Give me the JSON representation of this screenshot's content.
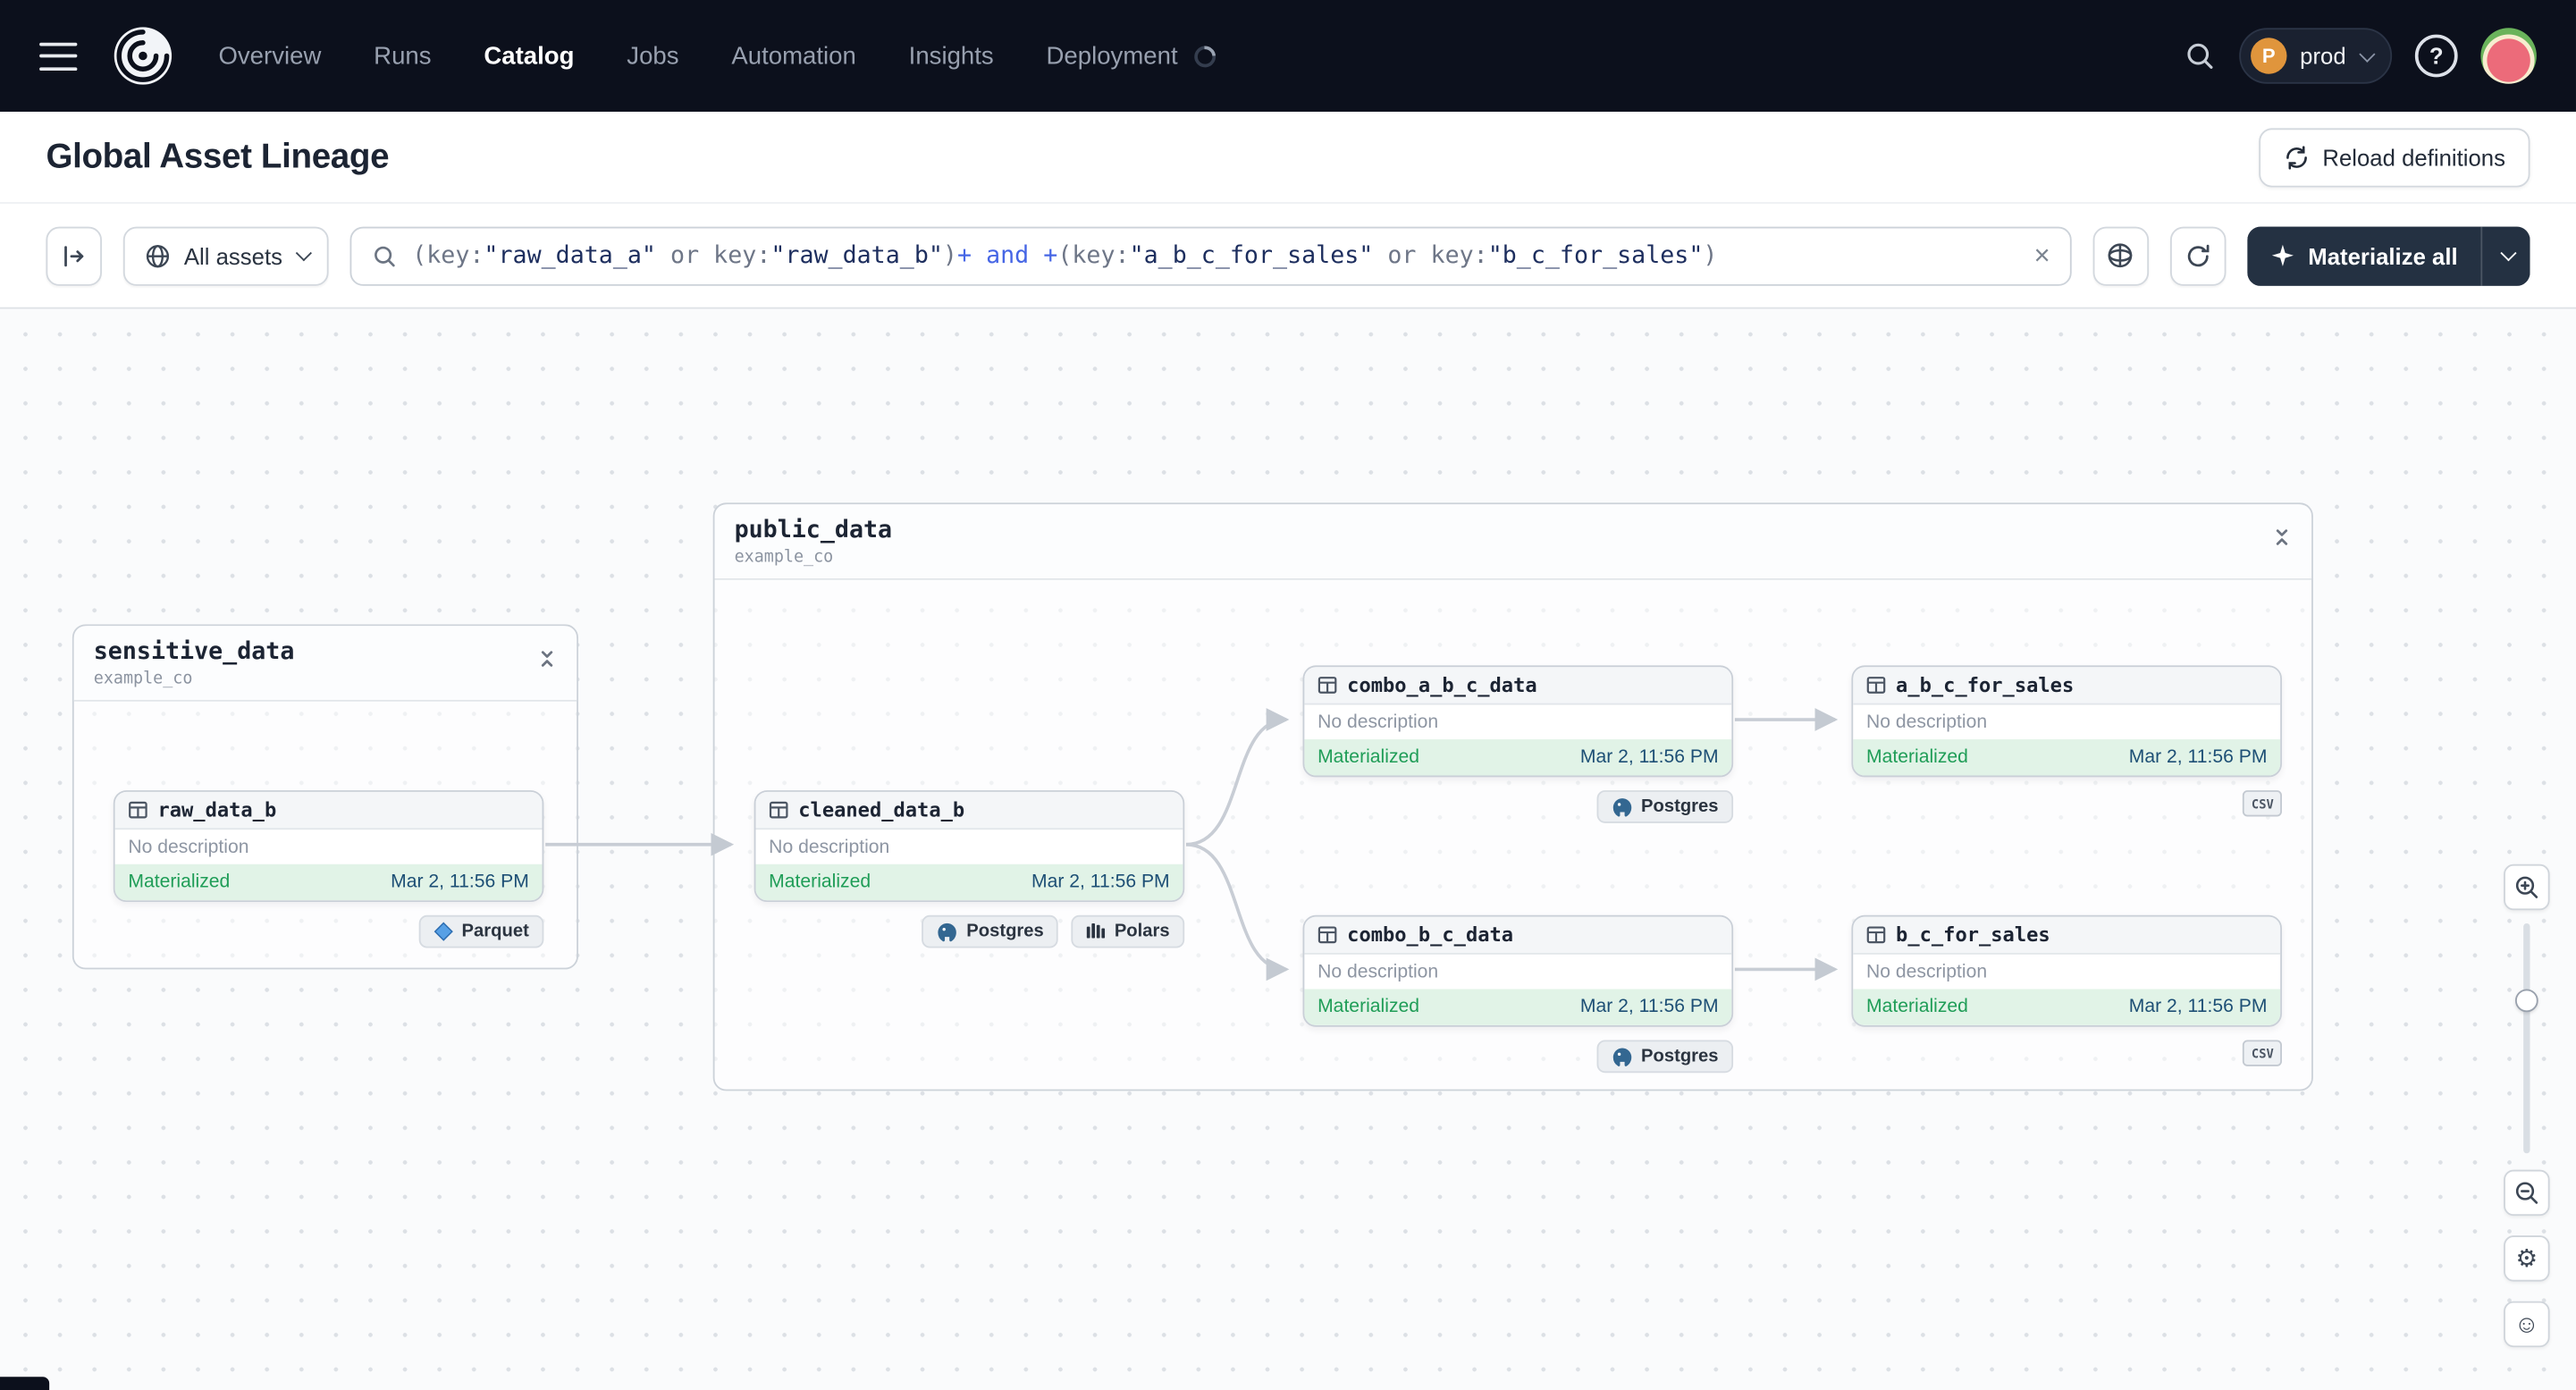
{
  "colors": {
    "nav_background": "#0c101c",
    "query_operator_blue": "#4666e5",
    "query_string_navy": "#1d2e5e",
    "query_plain_gray": "#6e7687",
    "materialized_background": "#e1f3e7",
    "materialized_green": "#1f9d57",
    "timestamp_navy": "#1d4f75",
    "primary_button_dark": "#243142",
    "postgres_blue": "#336791",
    "parquet_blue": "#57a0e5"
  },
  "nav": {
    "items": [
      {
        "label": "Overview"
      },
      {
        "label": "Runs"
      },
      {
        "label": "Catalog"
      },
      {
        "label": "Jobs"
      },
      {
        "label": "Automation"
      },
      {
        "label": "Insights"
      },
      {
        "label": "Deployment"
      }
    ],
    "active_item": "Catalog",
    "deployment_switcher": {
      "initial": "P",
      "name": "prod"
    },
    "help_glyph": "?"
  },
  "header": {
    "title": "Global Asset Lineage",
    "reload_button_label": "Reload definitions"
  },
  "toolbar": {
    "asset_filter_label": "All assets",
    "materialize_button_label": "Materialize all",
    "clear_glyph": "×",
    "search_query": "(key:\"raw_data_a\" or key:\"raw_data_b\")+ and +(key:\"a_b_c_for_sales\" or key:\"b_c_for_sales\")",
    "search_query_segments": [
      {
        "text": "(key:",
        "kind": "plain"
      },
      {
        "text": "\"raw_data_a\"",
        "kind": "string"
      },
      {
        "text": " or ",
        "kind": "plain"
      },
      {
        "text": "key:",
        "kind": "plain"
      },
      {
        "text": "\"raw_data_b\"",
        "kind": "string"
      },
      {
        "text": ")",
        "kind": "plain"
      },
      {
        "text": "+",
        "kind": "op"
      },
      {
        "text": " and ",
        "kind": "op"
      },
      {
        "text": "+",
        "kind": "op"
      },
      {
        "text": "(key:",
        "kind": "plain"
      },
      {
        "text": "\"a_b_c_for_sales\"",
        "kind": "string"
      },
      {
        "text": " or ",
        "kind": "plain"
      },
      {
        "text": "key:",
        "kind": "plain"
      },
      {
        "text": "\"b_c_for_sales\"",
        "kind": "string"
      },
      {
        "text": ")",
        "kind": "plain"
      }
    ]
  },
  "graph": {
    "groups": [
      {
        "name": "sensitive_data",
        "subtitle": "example_co"
      },
      {
        "name": "public_data",
        "subtitle": "example_co"
      }
    ],
    "nodes": [
      {
        "name": "raw_data_b",
        "description": "No description",
        "status": "Materialized",
        "timestamp": "Mar 2, 11:56 PM",
        "group": "sensitive_data",
        "tags": [
          {
            "label": "Parquet",
            "icon": "parquet-icon"
          }
        ]
      },
      {
        "name": "cleaned_data_b",
        "description": "No description",
        "status": "Materialized",
        "timestamp": "Mar 2, 11:56 PM",
        "group": "public_data",
        "tags": [
          {
            "label": "Postgres",
            "icon": "postgres-icon"
          },
          {
            "label": "Polars",
            "icon": "polars-icon"
          }
        ]
      },
      {
        "name": "combo_a_b_c_data",
        "description": "No description",
        "status": "Materialized",
        "timestamp": "Mar 2, 11:56 PM",
        "group": "public_data",
        "tags": [
          {
            "label": "Postgres",
            "icon": "postgres-icon"
          }
        ]
      },
      {
        "name": "a_b_c_for_sales",
        "description": "No description",
        "status": "Materialized",
        "timestamp": "Mar 2, 11:56 PM",
        "group": "public_data",
        "tags": [
          {
            "label": "csv",
            "icon": "csv-icon"
          }
        ]
      },
      {
        "name": "combo_b_c_data",
        "description": "No description",
        "status": "Materialized",
        "timestamp": "Mar 2, 11:56 PM",
        "group": "public_data",
        "tags": [
          {
            "label": "Postgres",
            "icon": "postgres-icon"
          }
        ]
      },
      {
        "name": "b_c_for_sales",
        "description": "No description",
        "status": "Materialized",
        "timestamp": "Mar 2, 11:56 PM",
        "group": "public_data",
        "tags": [
          {
            "label": "csv",
            "icon": "csv-icon"
          }
        ]
      }
    ],
    "edges": [
      {
        "from": "raw_data_b",
        "to": "cleaned_data_b"
      },
      {
        "from": "cleaned_data_b",
        "to": "combo_a_b_c_data"
      },
      {
        "from": "cleaned_data_b",
        "to": "combo_b_c_data"
      },
      {
        "from": "combo_a_b_c_data",
        "to": "a_b_c_for_sales"
      },
      {
        "from": "combo_b_c_data",
        "to": "b_c_for_sales"
      }
    ]
  }
}
